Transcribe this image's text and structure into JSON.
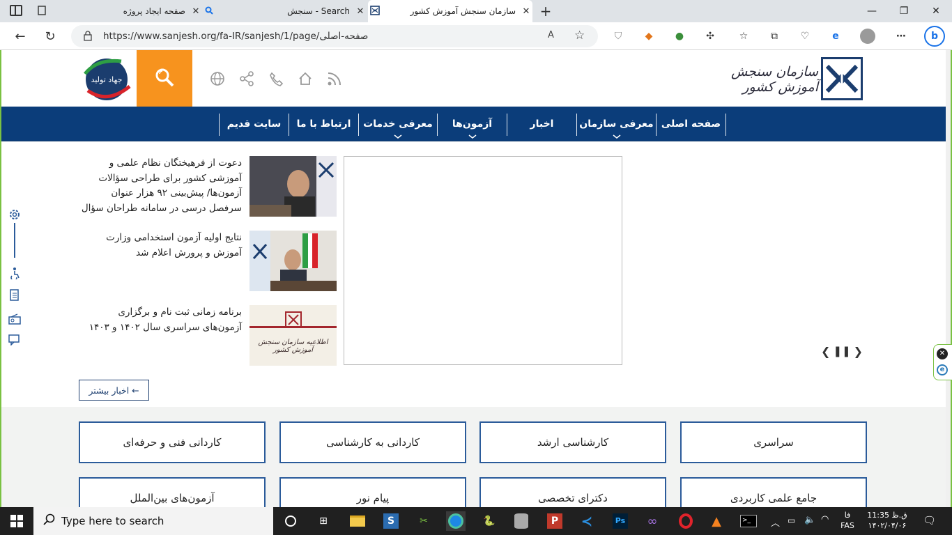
{
  "browser": {
    "tabs": [
      {
        "title": "صفحه ایجاد پروژه",
        "icon": "document-icon"
      },
      {
        "title": "سنجش - Search",
        "icon": "search-icon"
      },
      {
        "title": "سازمان سنجش آموزش کشور",
        "icon": "sanjesh-logo-icon",
        "active": true
      }
    ],
    "url": "https://www.sanjesh.org/fa-IR/sanjesh/1/page/صفحه-اصلی"
  },
  "header": {
    "logo_text": "سازمان سنجش آموزش کشور",
    "campaign_logo_text": "جهاد تولید"
  },
  "nav": {
    "items": [
      {
        "label": "صفحه اصلی",
        "dropdown": false
      },
      {
        "label": "معرفی سازمان",
        "dropdown": true
      },
      {
        "label": "اخبار",
        "dropdown": false
      },
      {
        "label": "آزمون‌ها",
        "dropdown": true
      },
      {
        "label": "معرفی خدمات",
        "dropdown": true
      },
      {
        "label": "ارتباط با ما",
        "dropdown": false
      },
      {
        "label": "سایت قدیم",
        "dropdown": false
      }
    ]
  },
  "news": [
    {
      "text": "دعوت از فرهیختگان نظام علمی و آموزشی کشور برای طراحی سؤالات آزمون‌ها/ پیش‌بینی ۹۲ هزار عنوان سرفصل درسی در سامانه طراحان سؤال"
    },
    {
      "text": "نتایج اولیه آزمون استخدامی وزارت آموزش و پرورش اعلام شد"
    },
    {
      "text": "برنامه زمانی ثبت نام و برگزاری آزمون‌های سراسری سال ۱۴۰۲ و ۱۴۰۳",
      "thumb_text": "اطلاعیه سازمان سنجش آموزش کشور"
    }
  ],
  "more_news_label": "اخبار بیشتر ←",
  "categories": [
    "سراسری",
    "کارشناسی ارشد",
    "کاردانی به کارشناسی",
    "کاردانی فنی و حرفه‌ای",
    "جامع علمی کاربردی",
    "دکترای تخصصی",
    "پیام نور",
    "آزمون‌های بین‌الملل"
  ],
  "taskbar": {
    "search_placeholder": "Type here to search",
    "time": "11:35 ق.ظ",
    "date": "۱۴۰۲/۰۴/۰۶",
    "lang_top": "فا",
    "lang_bottom": "FAS"
  },
  "colors": {
    "nav_bg": "#0b3d7a",
    "search_btn": "#f7931e",
    "category_border": "#2b5b9a"
  }
}
